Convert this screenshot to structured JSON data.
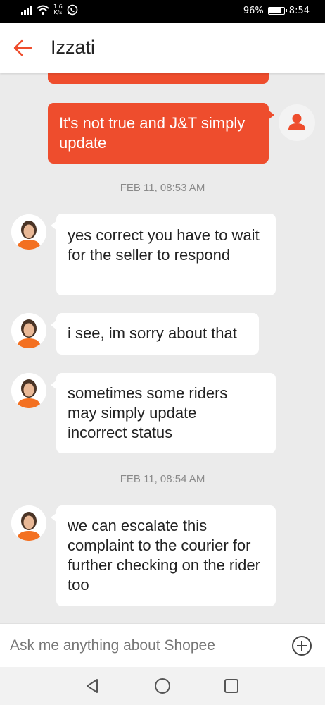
{
  "status_bar": {
    "net_speed_value": "1.6",
    "net_speed_unit": "K/s",
    "battery": "96%",
    "time": "8:54"
  },
  "header": {
    "title": "Izzati"
  },
  "messages": {
    "m1": {
      "text": "It's not true and J&T simply update"
    },
    "ts1": {
      "text": "FEB 11, 08:53 AM"
    },
    "m2": {
      "text": "yes correct you have to wait for the seller to respond"
    },
    "m3": {
      "text": "i see, im sorry about that"
    },
    "m4": {
      "text": "sometimes some riders may simply update incorrect status"
    },
    "ts2": {
      "text": "FEB 11, 08:54 AM"
    },
    "m5": {
      "text": "we can escalate this complaint to the courier for further checking on the rider too"
    }
  },
  "input": {
    "placeholder": "Ask me anything about Shopee",
    "value": ""
  },
  "colors": {
    "accent": "#ee4d2d",
    "background": "#ebebeb",
    "incoming_bubble": "#ffffff"
  },
  "icons": {
    "back": "arrow-left-icon",
    "user_avatar": "person-icon",
    "add": "plus-circle-icon",
    "nav_back": "triangle-back-icon",
    "nav_home": "circle-home-icon",
    "nav_recent": "square-recent-icon"
  }
}
